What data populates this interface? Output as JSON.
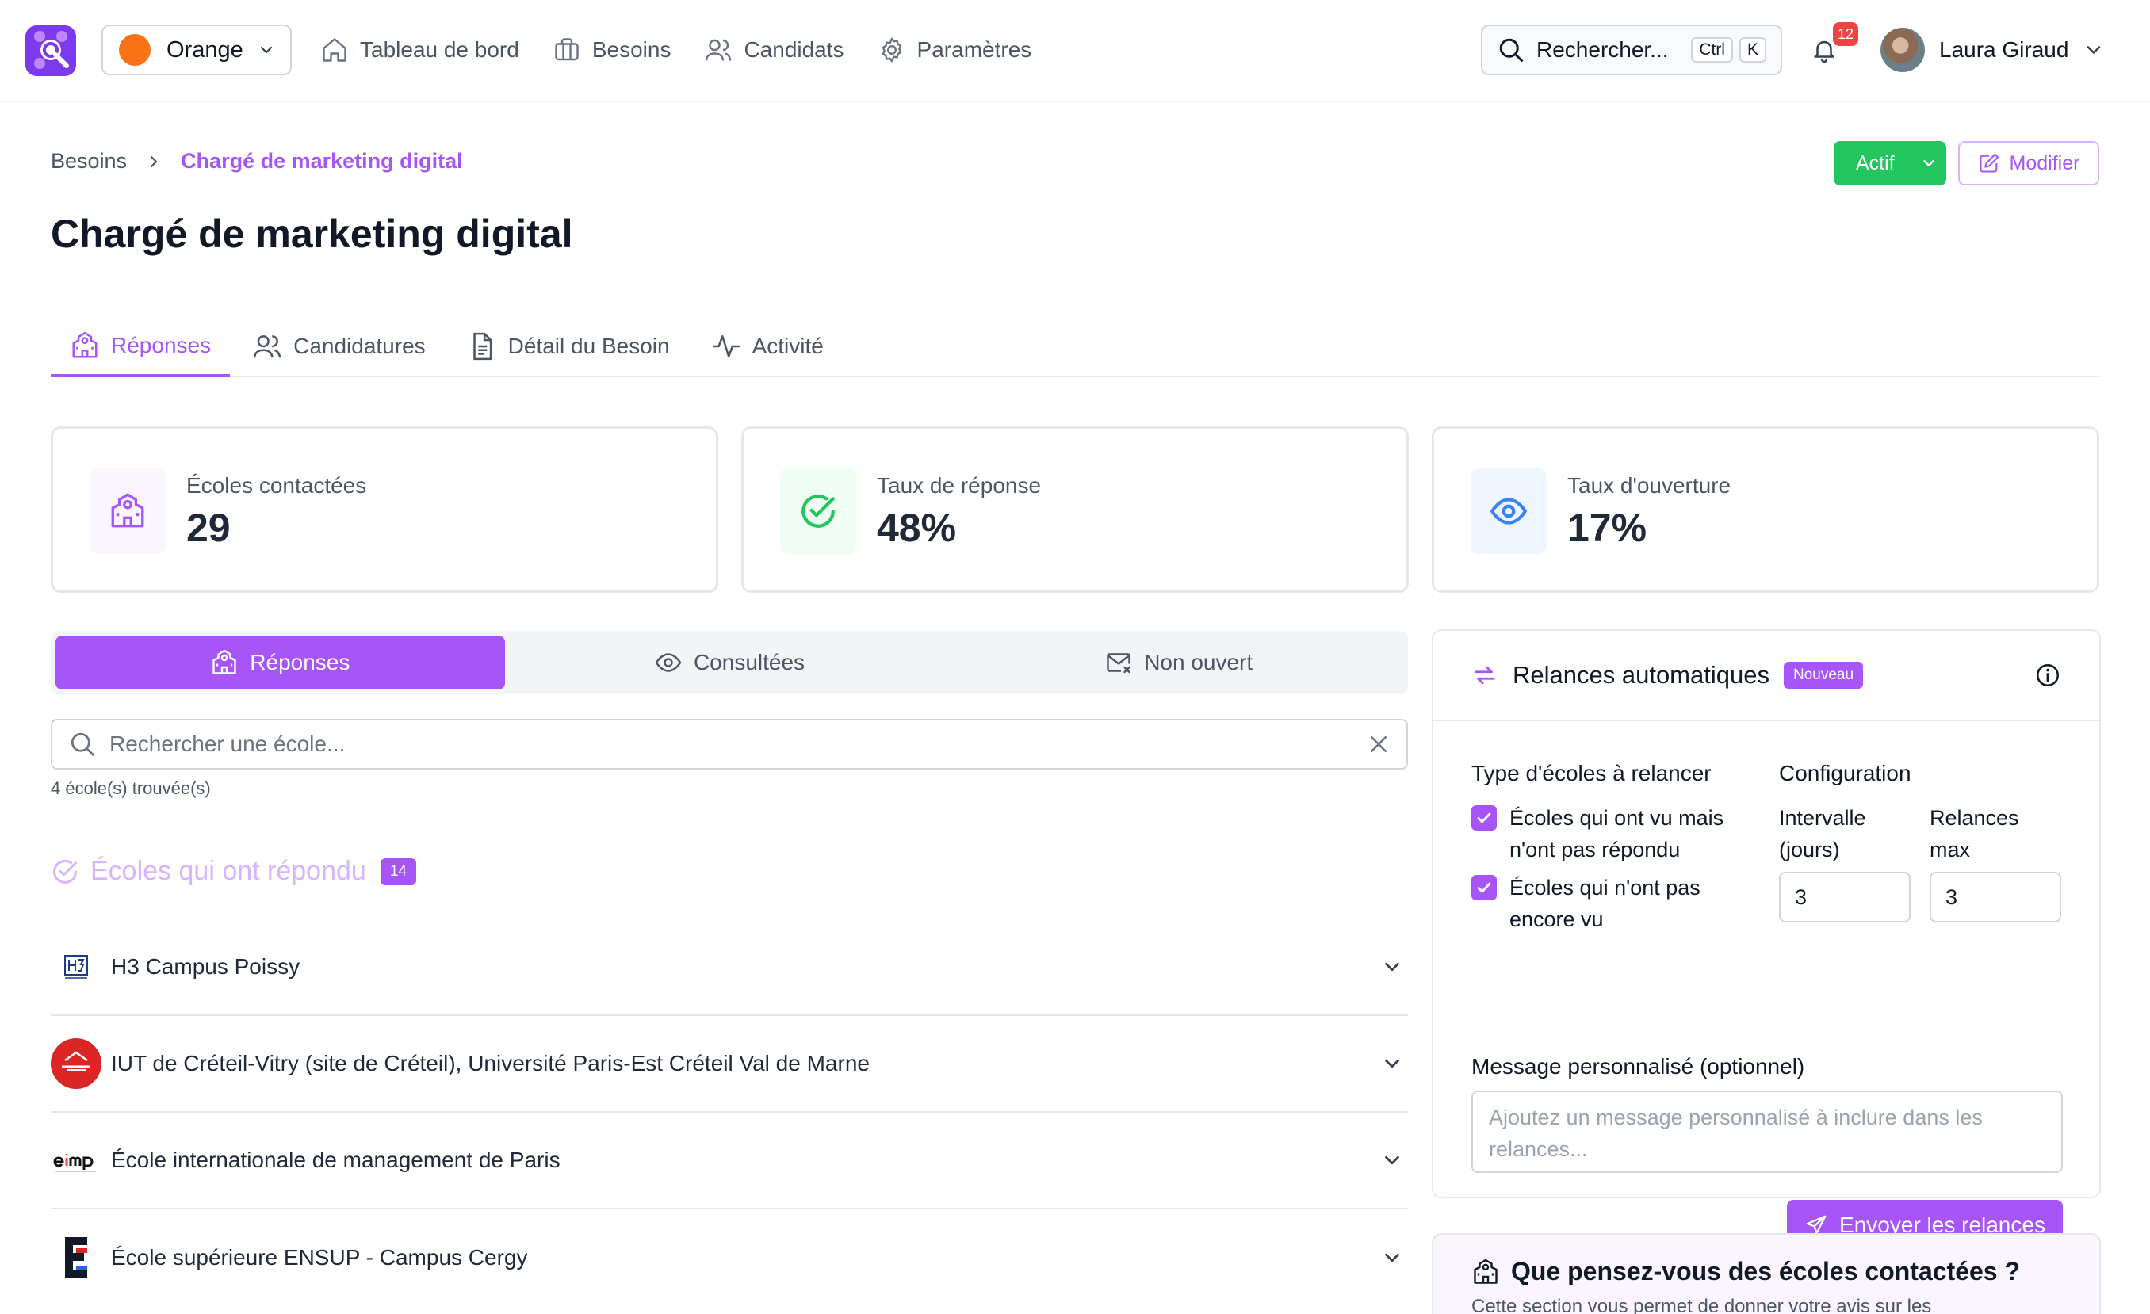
{
  "topbar": {
    "organization": "Orange",
    "nav": [
      {
        "label": "Tableau de bord",
        "icon": "home-icon"
      },
      {
        "label": "Besoins",
        "icon": "briefcase-icon"
      },
      {
        "label": "Candidats",
        "icon": "users-icon"
      },
      {
        "label": "Paramètres",
        "icon": "gear-icon"
      }
    ],
    "search": {
      "placeholder": "Rechercher...",
      "shortcut_ctrl": "Ctrl",
      "shortcut_key": "K"
    },
    "notifications_count": "12",
    "user_name": "Laura Giraud"
  },
  "header": {
    "breadcrumb_root": "Besoins",
    "breadcrumb_current": "Chargé de marketing digital",
    "status_label": "Actif",
    "edit_label": "Modifier",
    "title": "Chargé de marketing digital"
  },
  "tabs": [
    {
      "label": "Réponses",
      "active": true
    },
    {
      "label": "Candidatures",
      "active": false
    },
    {
      "label": "Détail du Besoin",
      "active": false
    },
    {
      "label": "Activité",
      "active": false
    }
  ],
  "stats": [
    {
      "label": "Écoles contactées",
      "value": "29",
      "color": "#a855f7"
    },
    {
      "label": "Taux de réponse",
      "value": "48%",
      "color": "#22c55e"
    },
    {
      "label": "Taux d'ouverture",
      "value": "17%",
      "color": "#3b82f6"
    }
  ],
  "segments": [
    {
      "label": "Réponses",
      "active": true
    },
    {
      "label": "Consultées",
      "active": false
    },
    {
      "label": "Non ouvert",
      "active": false
    }
  ],
  "school_search": {
    "placeholder": "Rechercher une école...",
    "found_text": "4 école(s) trouvée(s)"
  },
  "responded_section": {
    "title": "Écoles qui ont répondu",
    "count": "14"
  },
  "schools": [
    {
      "name": "H3 Campus Poissy",
      "logo": "H3"
    },
    {
      "name": "IUT de Créteil-Vitry (site de Créteil), Université Paris-Est Créteil Val de Marne",
      "logo": "UPEC"
    },
    {
      "name": "École internationale de management de Paris",
      "logo": "eimp"
    },
    {
      "name": "École supérieure ENSUP - Campus Cergy",
      "logo": "E"
    }
  ],
  "relances": {
    "title": "Relances automatiques",
    "badge": "Nouveau",
    "type_title": "Type d'écoles à relancer",
    "config_title": "Configuration",
    "option_1": [
      "Écoles qui ont vu mais",
      "n'ont pas répondu"
    ],
    "option_2": [
      "Écoles qui n'ont pas",
      "encore vu"
    ],
    "interval_label": [
      "Intervalle",
      "(jours)"
    ],
    "max_label": [
      "Relances",
      "max"
    ],
    "interval_value": "3",
    "max_value": "3",
    "message_label": "Message personnalisé (optionnel)",
    "message_placeholder": [
      "Ajoutez un message personnalisé à inclure dans les",
      "relances..."
    ],
    "send_label": "Envoyer les relances"
  },
  "feedback": {
    "title": "Que pensez-vous des écoles contactées ?",
    "subtitle": "Cette section vous permet de donner votre avis sur les"
  },
  "colors": {
    "accent": "#a855f7",
    "success": "#22c55e",
    "info": "#3b82f6",
    "danger": "#ef4444"
  }
}
